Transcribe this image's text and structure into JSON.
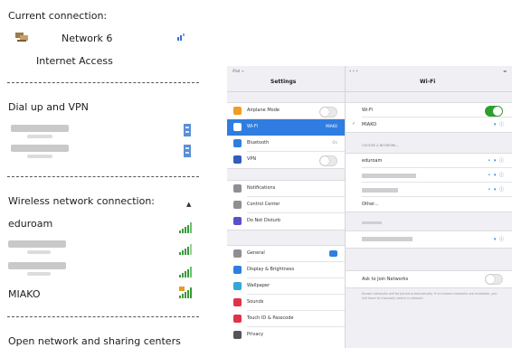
{
  "windows_panel": {
    "current_connection_label": "Current connection:",
    "network_name": "Network 6",
    "access_status": "Internet Access",
    "dialup_heading": "Dial up and VPN",
    "wireless_heading": "Wireless network connection:",
    "wifi_networks": [
      "eduroam",
      "MIAKO"
    ],
    "open_center_link": "Open network and sharing centers"
  },
  "colors": {
    "signal_green": "#3a9a3a",
    "ipad_blue": "#2f7de1",
    "toggle_green": "#2ca02c"
  },
  "ipad": {
    "sidebar_title": "Settings",
    "detail_title": "Wi-Fi",
    "sidebar_groups": [
      [
        "Airplane Mode",
        "Wi-Fi",
        "Bluetooth",
        "VPN"
      ],
      [
        "Notifications",
        "Control Center",
        "Do Not Disturb"
      ],
      [
        "General",
        "Display & Brightness",
        "Wallpaper",
        "Sounds",
        "Touch ID & Passcode",
        "Privacy"
      ]
    ],
    "wifi_row_value": "MIAKO",
    "bluetooth_value": "On",
    "wifi_label": "Wi-Fi",
    "connected_network": "MIAKO",
    "choose_network_caption": "CHOOSE A NETWORK...",
    "networks": [
      "eduroam",
      "",
      "",
      "Other..."
    ],
    "ask_join_label": "Ask to Join Networks",
    "ask_join_note": "Known networks will be joined automatically. If no known networks are available, you will have to manually select a network."
  }
}
